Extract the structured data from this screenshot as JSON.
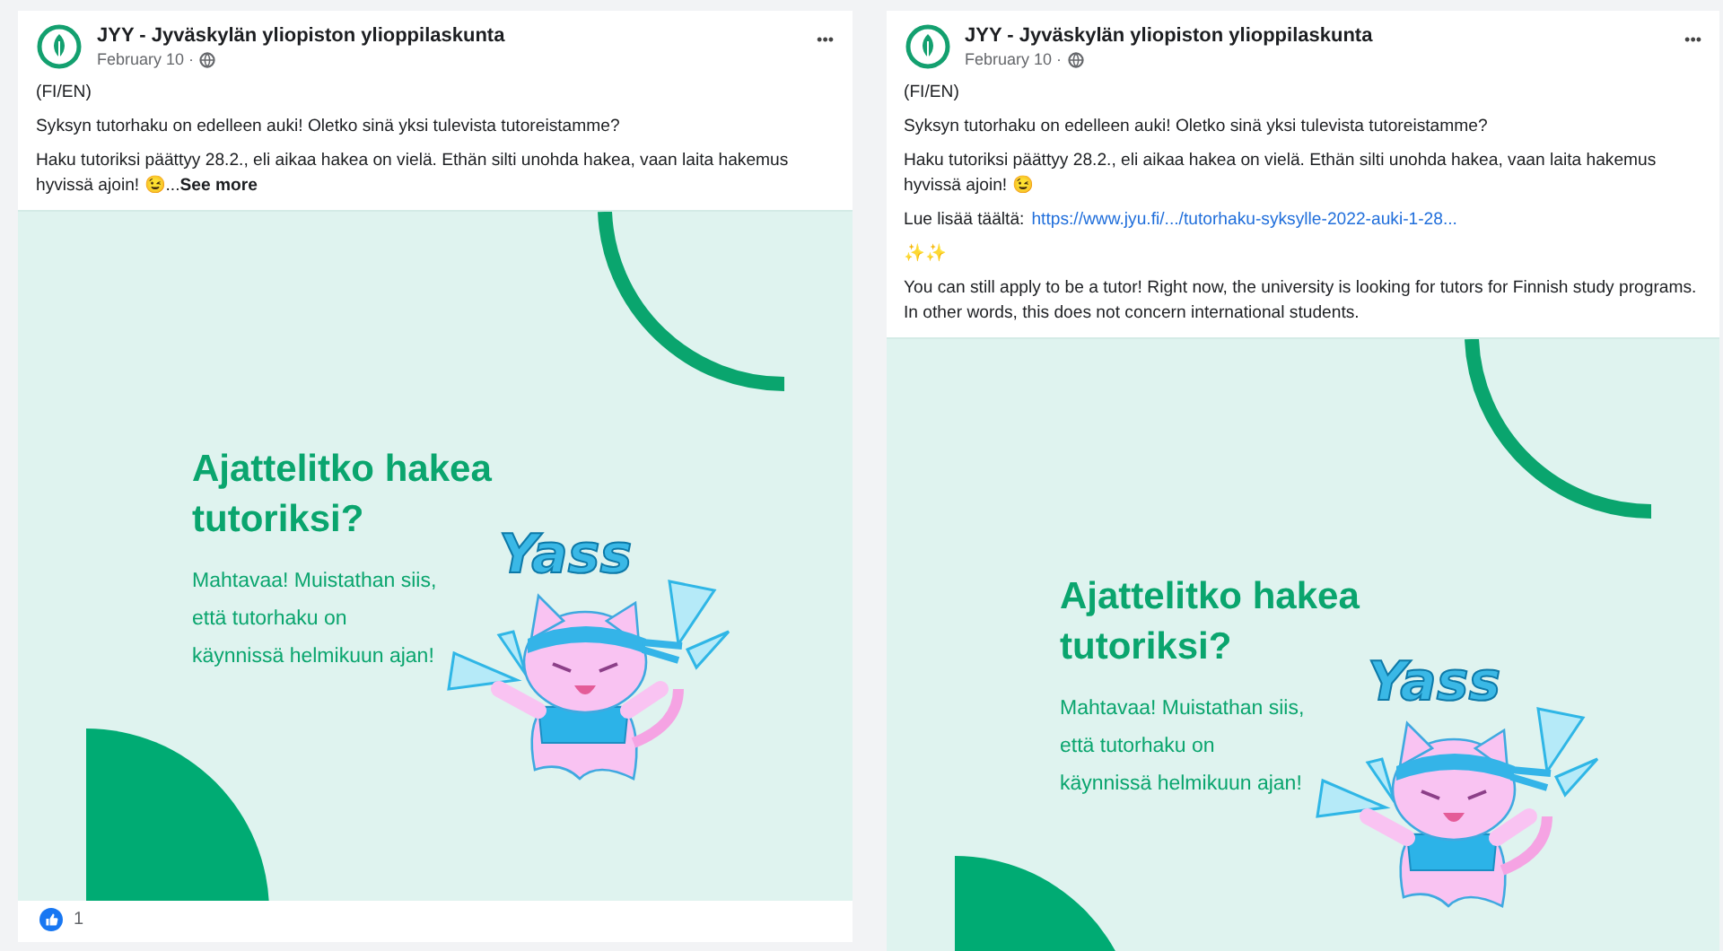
{
  "posts": [
    {
      "page_name": "JYY - Jyväskylän yliopiston ylioppilaskunta",
      "date": "February 10 ·",
      "menu": "•••",
      "paragraphs": [
        {
          "kind": "text",
          "text": "(FI/EN)"
        },
        {
          "kind": "text",
          "text": "Syksyn tutorhaku on edelleen auki! Oletko sinä yksi tulevista tutoreistamme?"
        },
        {
          "kind": "text",
          "text": "Haku tutoriksi päättyy 28.2., eli aikaa hakea on vielä. Ethän silti unohda hakea, vaan laita hakemus hyvissä ajoin! 😉..."
        }
      ],
      "see_more": "See more",
      "image": {
        "heading": "Ajattelitko hakea tutoriksi?",
        "body": "Mahtavaa! Muistathan siis, että tutorhaku on käynnissä helmikuun ajan!",
        "sticker_text": "Yass"
      },
      "reactions": "1"
    },
    {
      "page_name": "JYY - Jyväskylän yliopiston ylioppilaskunta",
      "date": "February 10 ·",
      "menu": "•••",
      "paragraphs": [
        {
          "kind": "text",
          "text": "(FI/EN)"
        },
        {
          "kind": "text",
          "text": "Syksyn tutorhaku on edelleen auki! Oletko sinä yksi tulevista tutoreistamme?"
        },
        {
          "kind": "text",
          "text": "Haku tutoriksi päättyy 28.2., eli aikaa hakea on vielä. Ethän silti unohda hakea, vaan laita hakemus hyvissä ajoin! 😉"
        },
        {
          "kind": "link",
          "label": "Lue lisää täältä:",
          "url": "https://www.jyu.fi/.../tutorhaku-syksylle-2022-auki-1-28..."
        },
        {
          "kind": "text",
          "text": "✨✨"
        },
        {
          "kind": "text",
          "text": "You can still apply to be a tutor! Right now, the university is looking for tutors for Finnish study programs. In other words, this does not concern international students."
        }
      ],
      "image": {
        "heading": "Ajattelitko hakea tutoriksi?",
        "body": "Mahtavaa! Muistathan siis, että tutorhaku on käynnissä helmikuun ajan!",
        "sticker_text": "Yass"
      }
    }
  ]
}
